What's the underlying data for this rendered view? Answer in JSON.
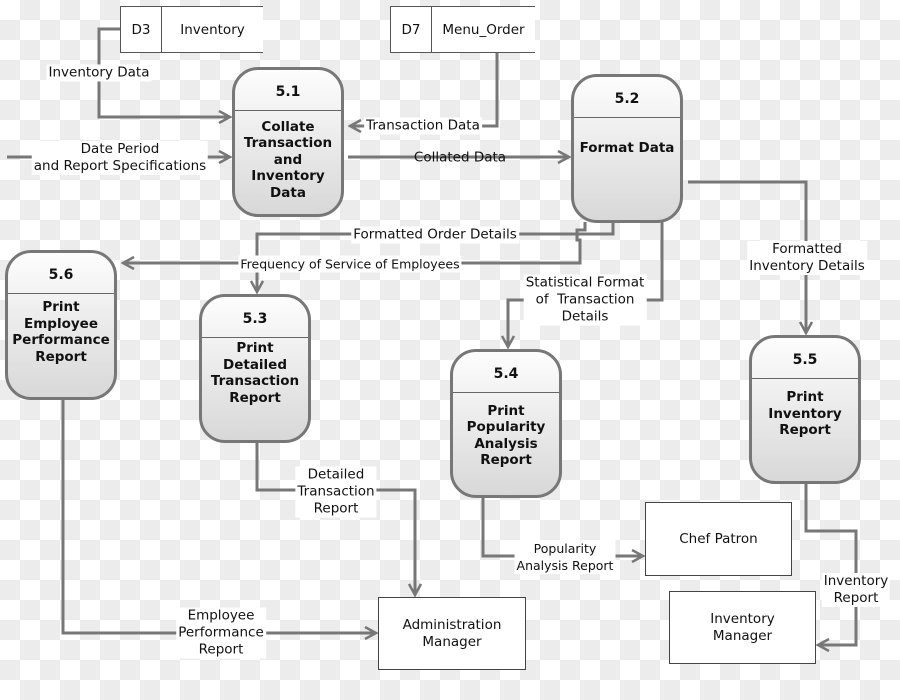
{
  "stores": [
    {
      "id": "D3",
      "name": "Inventory"
    },
    {
      "id": "D7",
      "name": "Menu_Order"
    }
  ],
  "processes": [
    {
      "num": "5.1",
      "name": "Collate Transaction and Inventory Data"
    },
    {
      "num": "5.2",
      "name": "Format Data"
    },
    {
      "num": "5.3",
      "name": "Print Detailed Transaction Report"
    },
    {
      "num": "5.4",
      "name": "Print Popularity Analysis Report"
    },
    {
      "num": "5.5",
      "name": "Print Inventory Report"
    },
    {
      "num": "5.6",
      "name": "Print Employee Performance Report"
    }
  ],
  "entities": {
    "chef": "Chef Patron",
    "admin": "Administration Manager",
    "inventory_mgr": "Inventory Manager"
  },
  "flows": {
    "inventory_data": "Inventory Data",
    "date_period": "Date Period\nand Report Specifications",
    "transaction_data": "Transaction Data",
    "collated_data": "Collated Data",
    "formatted_order": "Formatted Order Details",
    "frequency": "Frequency of Service of Employees",
    "statistical": "Statistical Format\nof  Transaction\nDetails",
    "formatted_inventory": "Formatted\nInventory Details",
    "employee_perf": "Employee\nPerformance\nReport",
    "detailed_trans": "Detailed\nTransaction\nReport",
    "popularity": "Popularity\nAnalysis Report",
    "inventory_report": "Inventory\nReport"
  },
  "colors": {
    "line": "#777777",
    "process_top": "#fdfdfd",
    "process_bottom": "#d8d8d8"
  }
}
